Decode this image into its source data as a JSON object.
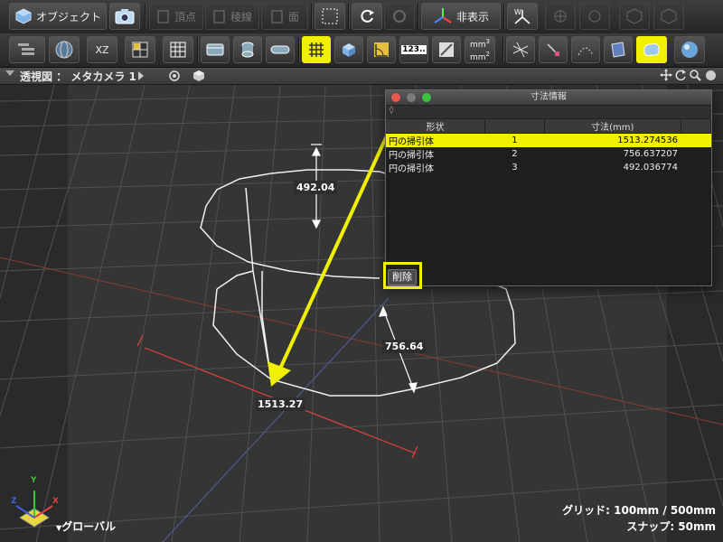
{
  "toolbar1": {
    "object_label": "オブジェクト",
    "vertex_label": "頂点",
    "edge_label": "稜線",
    "face_label": "面",
    "hide_label": "非表示"
  },
  "toolbar2": {
    "plane_label": "XZ",
    "number_label": "123..",
    "area_unit_top": "mm",
    "area_unit_top_sup": "2",
    "area_unit_bottom": "mm",
    "area_unit_bottom_sup": "3"
  },
  "viewport": {
    "title": "透視図 ： メタカメラ 1",
    "labels": {
      "height": "492.04",
      "radius": "756.64",
      "length": "1513.27"
    },
    "axis_global": "グローバル",
    "axis_y": "Y",
    "axis_x": "X",
    "axis_z": "Z",
    "grid_status": "グリッド: 100mm / 500mm",
    "snap_status": "スナップ: 50mm"
  },
  "panel": {
    "title": "寸法情報",
    "columns": [
      "形状",
      "",
      "寸法(mm)"
    ],
    "rows": [
      {
        "shape": "円の掃引体",
        "index": "1",
        "value": "1513.274536"
      },
      {
        "shape": "円の掃引体",
        "index": "2",
        "value": "756.637207"
      },
      {
        "shape": "円の掃引体",
        "index": "3",
        "value": "492.036774"
      }
    ],
    "delete_label": "削除"
  },
  "colors": {
    "highlight": "#f0f000",
    "toolbar_bg": "#333333",
    "viewport_bg": "#353535",
    "grid_line": "#555555",
    "dim_line_red": "#e04040",
    "model_line": "#ffffff"
  },
  "icons": [
    "cube-icon",
    "camera-icon",
    "vertex-icon",
    "edge-icon",
    "face-icon",
    "selection-rect-icon",
    "rotate-icon",
    "tool-icon",
    "axis-icon",
    "world-axis-icon",
    "target-icon",
    "grid-icon",
    "layers-icon"
  ]
}
